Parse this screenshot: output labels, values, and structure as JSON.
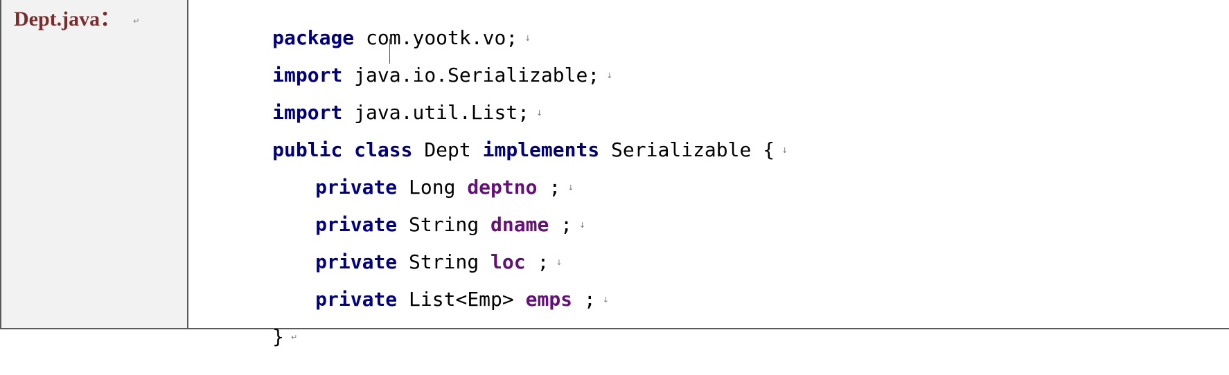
{
  "label": {
    "file_name": "Dept.java：",
    "mark": "↵"
  },
  "code": {
    "line1": {
      "kw": "package",
      "text": " com.yootk.vo;",
      "mark": "↓"
    },
    "line2": {
      "kw": "import",
      "text": " java.io.Serializable;",
      "mark": "↓"
    },
    "line3": {
      "kw": "import",
      "text": " java.util.List;",
      "mark": "↓"
    },
    "line4": {
      "kw1": "public",
      "sp1": " ",
      "kw2": "class",
      "text1": " Dept ",
      "kw3": "implements",
      "text2": " Serializable {",
      "mark": "↓"
    },
    "line5": {
      "kw": "private",
      "type": " Long ",
      "field": "deptno",
      "end": " ;",
      "mark": "↓"
    },
    "line6": {
      "kw": "private",
      "type": " String ",
      "field": "dname",
      "end": " ;",
      "mark": "↓"
    },
    "line7": {
      "kw": "private",
      "type": " String ",
      "field": "loc",
      "end": " ;",
      "mark": "↓"
    },
    "line8": {
      "kw": "private",
      "type": " List<Emp> ",
      "field": "emps",
      "end": " ;",
      "mark": "↓"
    },
    "line9": {
      "text": "}",
      "mark": "↵"
    }
  }
}
